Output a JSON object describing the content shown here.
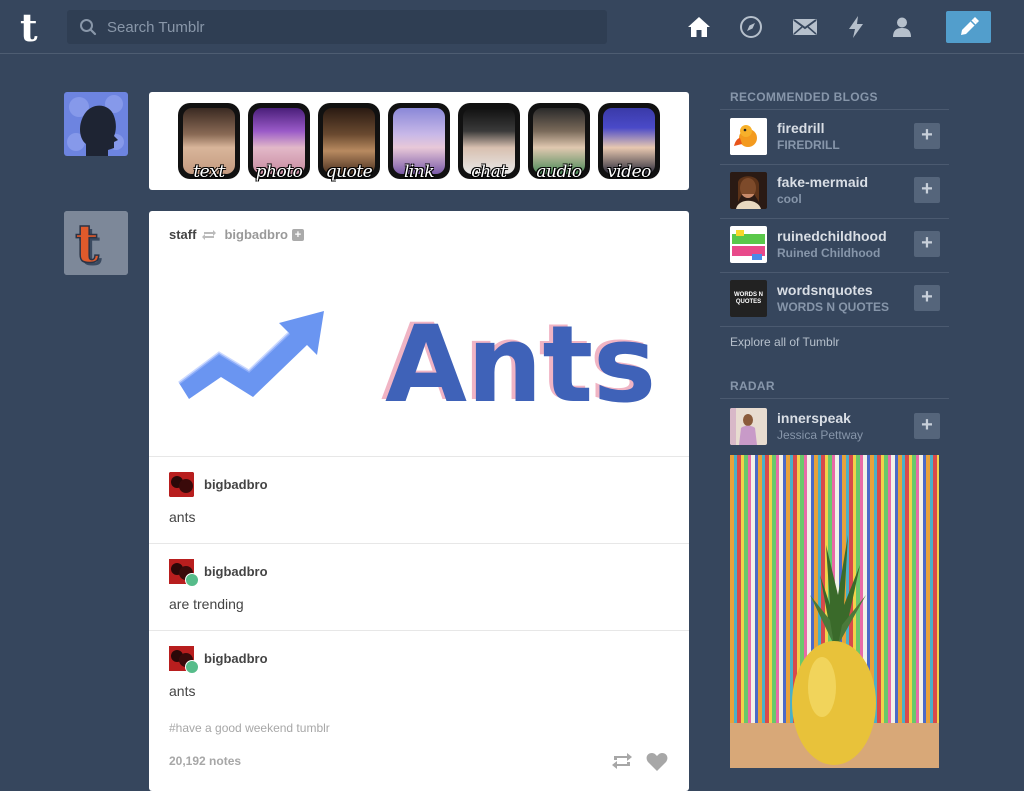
{
  "header": {
    "search_placeholder": "Search Tumblr",
    "logo_letter": "t"
  },
  "post_form": {
    "types": [
      "text",
      "photo",
      "quote",
      "link",
      "chat",
      "audio",
      "video"
    ]
  },
  "post": {
    "author": "staff",
    "reblogged_from": "bigbadbro",
    "banner_word": "Ants",
    "reblogs": [
      {
        "name": "bigbadbro",
        "text": "ants",
        "badge": false
      },
      {
        "name": "bigbadbro",
        "text": "are trending",
        "badge": true
      },
      {
        "name": "bigbadbro",
        "text": "ants",
        "badge": true
      }
    ],
    "tags": "#have a good weekend tumblr",
    "notes": "20,192 notes"
  },
  "sidebar": {
    "recommended_title": "RECOMMENDED BLOGS",
    "blogs": [
      {
        "name": "firedrill",
        "subtitle": "FIREDRILL"
      },
      {
        "name": "fake-mermaid",
        "subtitle": "cool"
      },
      {
        "name": "ruinedchildhood",
        "subtitle": "Ruined Childhood"
      },
      {
        "name": "wordsnquotes",
        "subtitle": "WORDS N QUOTES",
        "avatar_text": "WORDS N QUOTES"
      }
    ],
    "explore_label": "Explore all of Tumblr",
    "radar_title": "RADAR",
    "radar": {
      "name": "innerspeak",
      "subtitle": "Jessica Pettway"
    }
  },
  "colors": {
    "background": "#36465d",
    "accent": "#529ecc",
    "reblog_badge": "#56bc8a"
  }
}
